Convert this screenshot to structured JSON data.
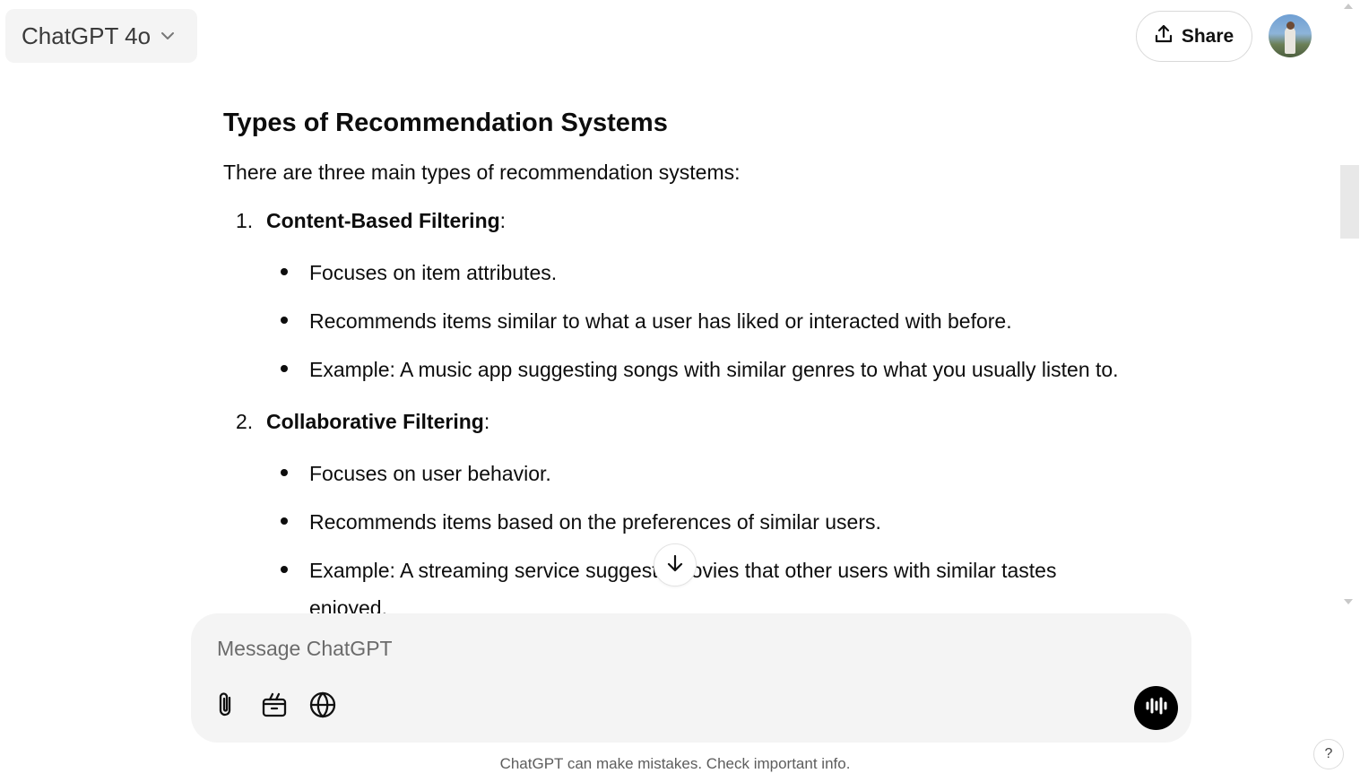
{
  "header": {
    "model_name": "ChatGPT 4o",
    "share_label": "Share"
  },
  "message": {
    "heading": "Types of Recommendation Systems",
    "intro": "There are three main types of recommendation systems:",
    "types": [
      {
        "number": "1.",
        "name": "Content-Based Filtering",
        "suffix": ":",
        "points": [
          "Focuses on item attributes.",
          "Recommends items similar to what a user has liked or interacted with before.",
          "Example: A music app suggesting songs with similar genres to what you usually listen to."
        ]
      },
      {
        "number": "2.",
        "name": "Collaborative Filtering",
        "suffix": ":",
        "points": [
          "Focuses on user behavior.",
          "Recommends items based on the preferences of similar users.",
          "Example: A streaming service suggests movies that other users with similar tastes enjoyed."
        ]
      }
    ]
  },
  "composer": {
    "placeholder": "Message ChatGPT"
  },
  "footer": {
    "disclaimer": "ChatGPT can make mistakes. Check important info.",
    "help_label": "?"
  },
  "icons": {
    "model_chevron": "chevron-down-icon",
    "share": "share-upload-icon",
    "scroll_to_bottom": "arrow-down-icon",
    "attach": "paperclip-icon",
    "tools": "toolbox-icon",
    "search_web": "globe-icon",
    "voice": "voice-waveform-icon"
  }
}
